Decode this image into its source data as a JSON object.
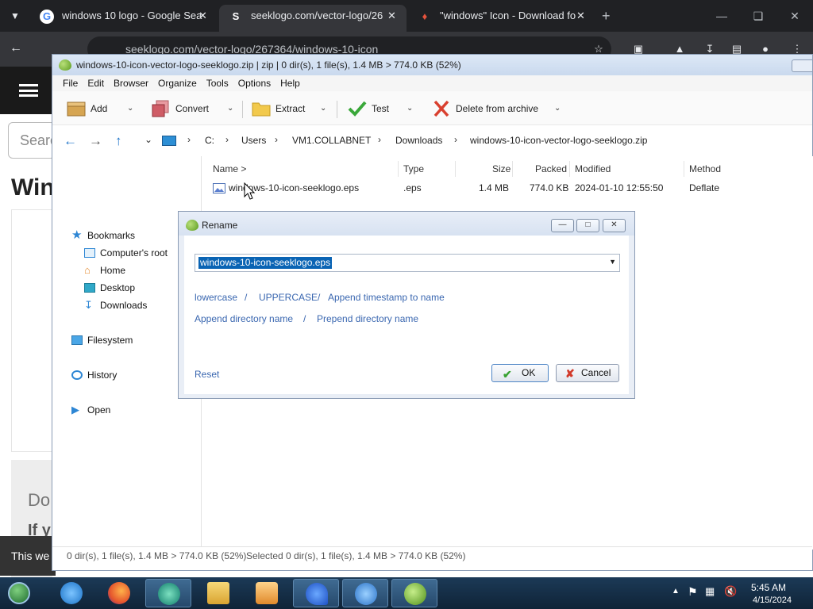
{
  "browser": {
    "tabs": [
      {
        "title": "windows 10 logo - Google Sea",
        "favicon": "G",
        "active": false
      },
      {
        "title": "seeklogo.com/vector-logo/26",
        "favicon": "S",
        "active": true
      },
      {
        "title": "\"windows\" Icon - Download fo",
        "favicon": "♦",
        "active": false
      }
    ],
    "address": "seeklogo.com/vector-logo/267364/windows-10-icon",
    "new_tab": "+"
  },
  "webpage": {
    "search_placeholder": "Search",
    "heading": "Win",
    "do_text": "Do",
    "if_text": "If y",
    "cookie_text": "This we"
  },
  "peazip": {
    "title": "windows-10-icon-vector-logo-seeklogo.zip | zip | 0 dir(s), 1 file(s), 1.4 MB > 774.0 KB (52%)",
    "menu": [
      "File",
      "Edit",
      "Browser",
      "Organize",
      "Tools",
      "Options",
      "Help"
    ],
    "tools": [
      {
        "label": "Add",
        "icon": "box-icon"
      },
      {
        "label": "Convert",
        "icon": "convert-icon"
      },
      {
        "label": "Extract",
        "icon": "folder-icon"
      },
      {
        "label": "Test",
        "icon": "check-icon"
      },
      {
        "label": "Delete from archive",
        "icon": "delete-icon"
      }
    ],
    "breadcrumb": [
      "C:",
      "Users",
      "VM1.COLLABNET",
      "Downloads",
      "windows-10-icon-vector-logo-seeklogo.zip"
    ],
    "sidebar": {
      "bookmarks": "Bookmarks",
      "items": [
        "Computer's root",
        "Home",
        "Desktop",
        "Downloads"
      ],
      "filesystem": "Filesystem",
      "history": "History",
      "open": "Open"
    },
    "columns": [
      "Name >",
      "Type",
      "Size",
      "Packed",
      "Modified",
      "Method"
    ],
    "files": [
      {
        "name": "windows-10-icon-seeklogo.eps",
        "type": ".eps",
        "size": "1.4 MB",
        "packed": "774.0 KB",
        "modified": "2024-01-10 12:55:50",
        "method": "Deflate"
      }
    ],
    "status_left": "0 dir(s), 1 file(s), 1.4 MB > 774.0 KB (52%)",
    "status_right": "Selected 0 dir(s), 1 file(s), 1.4 MB > 774.0 KB (52%)"
  },
  "rename_dialog": {
    "title": "Rename",
    "value": "windows-10-icon-seeklogo.eps",
    "links": {
      "lowercase": "lowercase",
      "uppercase": "UPPERCASE",
      "append_timestamp": "Append timestamp to name",
      "append_dir": "Append directory name",
      "prepend_dir": "Prepend directory name",
      "sep": "/"
    },
    "reset": "Reset",
    "ok": "OK",
    "cancel": "Cancel"
  },
  "taskbar": {
    "time": "5:45 AM",
    "date": "4/15/2024"
  },
  "colors": {
    "chrome_dark": "#202124",
    "peazip_title": "#c9d9ee",
    "link_blue": "#3a67b0",
    "selection": "#0a64b4",
    "taskbar": "#1c3a57"
  }
}
